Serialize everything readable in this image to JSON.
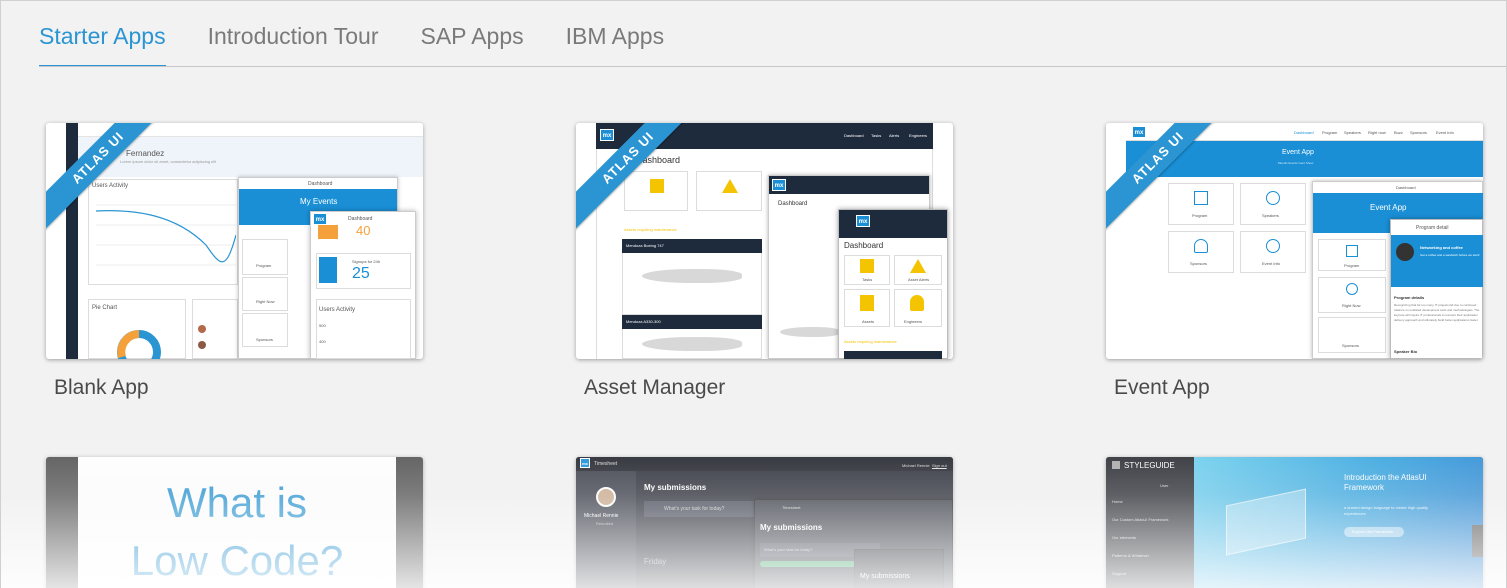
{
  "tabs": [
    {
      "label": "Starter Apps",
      "active": true
    },
    {
      "label": "Introduction Tour",
      "active": false
    },
    {
      "label": "SAP Apps",
      "active": false
    },
    {
      "label": "IBM Apps",
      "active": false
    }
  ],
  "cards": [
    {
      "title": "Blank App",
      "ribbon": "ATLAS UI"
    },
    {
      "title": "Asset Manager",
      "ribbon": "ATLAS UI"
    },
    {
      "title": "Event App",
      "ribbon": "ATLAS UI"
    }
  ],
  "blank_app_preview": {
    "user": "Fernandez",
    "subtitle": "Lorem ipsum dolor sit amet, consectetur adipiscing elit",
    "users_activity": "Users Activity",
    "pie_chart": "Pie Chart",
    "dashboard": "Dashboard",
    "my_events": "My Events",
    "count_top": "40",
    "signups_label": "Signups for 24h",
    "signups_value": "25",
    "users_activity_2": "Users Activity",
    "axis_500": "500",
    "axis_400": "400",
    "program": "Program",
    "right_now": "Right Now",
    "sponsors": "Sponsors",
    "mx": "mx"
  },
  "asset_preview": {
    "nav": [
      "Dashboard",
      "Tasks",
      "Alerts",
      "Engineers"
    ],
    "heading": "Dashboard",
    "section": "Assets requiring maintenance",
    "plane1": "Mendoza Boeing 747",
    "plane2": "Mendoza A330-300",
    "tiles": [
      "Tasks",
      "Asset Alerts",
      "Assets",
      "Engineers"
    ],
    "mx": "mx"
  },
  "event_preview": {
    "nav": [
      "Dashboard",
      "Program",
      "Speakers",
      "Right now",
      "Buzz",
      "Sponsors",
      "Event info"
    ],
    "title": "Event App",
    "subtitle": "Mendix Events Gent Show",
    "tiles": [
      "Program",
      "Speakers",
      "Sponsors",
      "Event Info"
    ],
    "panel_header": "Dashboard",
    "program_detail": "Program detail",
    "networking": "Networking  and coffee",
    "networking_sub": "Get a coffee and a sandwich before we start!",
    "program_details": "Program details",
    "details_text": "Recognizing that far too many IT projects fail due to continued reliance on outdated development tools and methodologies. The keynote will inspire IT professionals to reinvent their application delivery approach and ultimately build better applications faster.",
    "speaker_bio": "Speaker Bio",
    "right_now": "Right Now",
    "mx": "mx"
  },
  "lowcode_preview": {
    "line1": "What is",
    "line2": "Low Code?"
  },
  "timesheet_preview": {
    "app": "Timesheet",
    "user": "Michael Rennie",
    "role": "Recruited",
    "heading": "My submissions",
    "placeholder": "What's your task for today?",
    "day": "Friday",
    "signout": "Sign out",
    "mx": "mx"
  },
  "styleguide_preview": {
    "brand": "STYLEGUIDE",
    "user": "User",
    "menu": [
      "Home",
      "Our Custom AtlasUI Framework",
      "Our elements",
      "Patterns & Whatever",
      "Support"
    ],
    "hero_title": "Introduction the AtlasUI Framework",
    "hero_sub": "a shared design language to create high quality experiences",
    "hero_button": "Explore the Framework",
    "feedback": "Feedback"
  },
  "colors": {
    "accent": "#2a95d2",
    "dark_nav": "#1e2b3c",
    "yellow": "#f4c400"
  }
}
